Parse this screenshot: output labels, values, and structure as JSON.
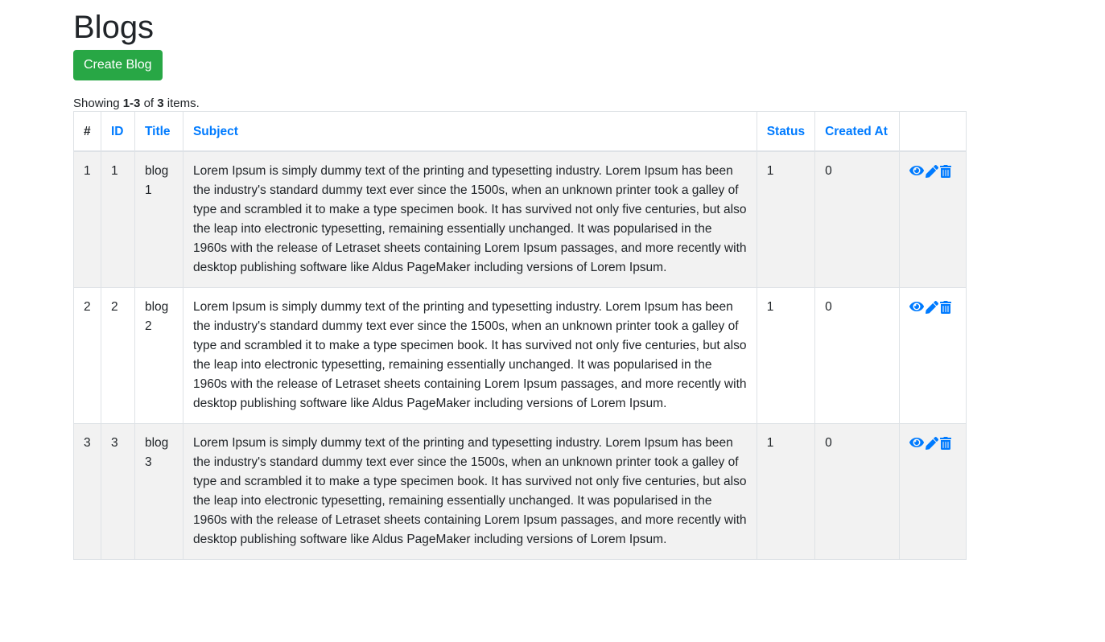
{
  "page": {
    "title": "Blogs",
    "create_button": "Create Blog"
  },
  "summary": {
    "prefix": "Showing ",
    "range": "1-3",
    "of": " of ",
    "total": "3",
    "suffix": " items."
  },
  "table": {
    "headers": {
      "hash": "#",
      "id": "ID",
      "title": "Title",
      "subject": "Subject",
      "status": "Status",
      "created_at": "Created At"
    },
    "rows": [
      {
        "num": "1",
        "id": "1",
        "title": "blog 1",
        "subject": "Lorem Ipsum is simply dummy text of the printing and typesetting industry. Lorem Ipsum has been the industry's standard dummy text ever since the 1500s, when an unknown printer took a galley of type and scrambled it to make a type specimen book. It has survived not only five centuries, but also the leap into electronic typesetting, remaining essentially unchanged. It was popularised in the 1960s with the release of Letraset sheets containing Lorem Ipsum passages, and more recently with desktop publishing software like Aldus PageMaker including versions of Lorem Ipsum.",
        "status": "1",
        "created_at": "0"
      },
      {
        "num": "2",
        "id": "2",
        "title": "blog 2",
        "subject": "Lorem Ipsum is simply dummy text of the printing and typesetting industry. Lorem Ipsum has been the industry's standard dummy text ever since the 1500s, when an unknown printer took a galley of type and scrambled it to make a type specimen book. It has survived not only five centuries, but also the leap into electronic typesetting, remaining essentially unchanged. It was popularised in the 1960s with the release of Letraset sheets containing Lorem Ipsum passages, and more recently with desktop publishing software like Aldus PageMaker including versions of Lorem Ipsum.",
        "status": "1",
        "created_at": "0"
      },
      {
        "num": "3",
        "id": "3",
        "title": "blog 3",
        "subject": "Lorem Ipsum is simply dummy text of the printing and typesetting industry. Lorem Ipsum has been the industry's standard dummy text ever since the 1500s, when an unknown printer took a galley of type and scrambled it to make a type specimen book. It has survived not only five centuries, but also the leap into electronic typesetting, remaining essentially unchanged. It was popularised in the 1960s with the release of Letraset sheets containing Lorem Ipsum passages, and more recently with desktop publishing software like Aldus PageMaker including versions of Lorem Ipsum.",
        "status": "1",
        "created_at": "0"
      }
    ],
    "row_actions": [
      "eye-icon",
      "pencil-icon",
      "trash-icon"
    ]
  },
  "colors": {
    "link": "#007bff",
    "success": "#28a745",
    "stripe": "#f2f2f2",
    "border": "#dee2e6",
    "text": "#212529"
  }
}
